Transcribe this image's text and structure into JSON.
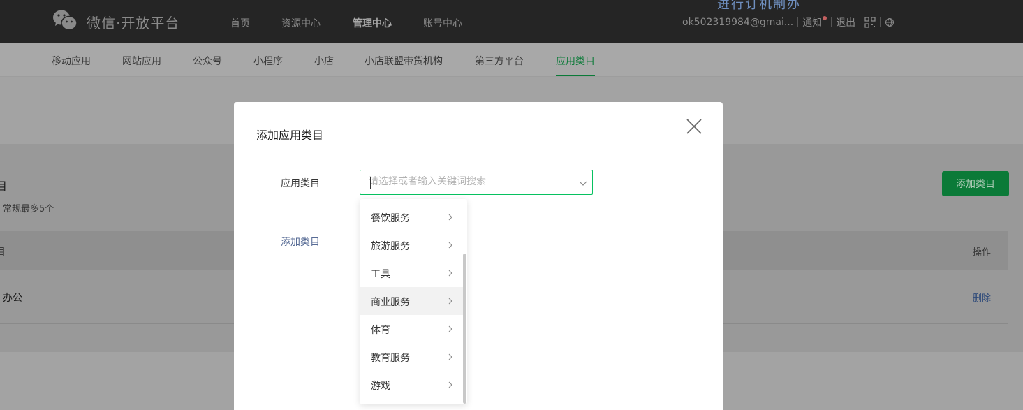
{
  "header": {
    "brand": "微信·开放平台",
    "nav": [
      "首页",
      "资源中心",
      "管理中心",
      "账号中心"
    ],
    "active_nav": "管理中心",
    "account": "ok502319984@gmai...",
    "notice": "通知",
    "logout": "退出",
    "cutoff_text": "进行订机制办"
  },
  "subnav": {
    "items": [
      "移动应用",
      "网站应用",
      "公众号",
      "小程序",
      "小店",
      "小店联盟带货机构",
      "第三方平台",
      "应用类目"
    ],
    "active": "应用类目"
  },
  "page": {
    "title_partial": "目",
    "hint": "常规最多5个",
    "add_button": "添加类目",
    "table_header_partial": "目",
    "table_header_ops": "操作",
    "row_category_partial": "办公",
    "row_delete": "删除"
  },
  "modal": {
    "title": "添加应用类目",
    "field_label": "应用类目",
    "select_placeholder": "请选择或者输入关键词搜索",
    "add_link": "添加类目"
  },
  "dropdown": {
    "items": [
      "餐饮服务",
      "旅游服务",
      "工具",
      "商业服务",
      "体育",
      "教育服务",
      "游戏"
    ],
    "hovered": "商业服务"
  },
  "colors": {
    "brand_green": "#07c160",
    "link_blue": "#576b95",
    "topbar": "#252525"
  }
}
